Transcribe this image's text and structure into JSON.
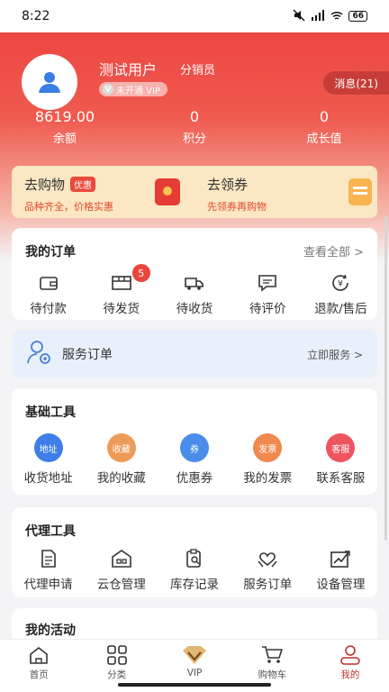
{
  "status": {
    "time": "8:22",
    "battery": "66"
  },
  "profile": {
    "username": "测试用户",
    "role": "分销员",
    "vip_status": "未开通 VIP",
    "messages_label": "消息(21)"
  },
  "stats": [
    {
      "value": "8619.00",
      "label": "余额"
    },
    {
      "value": "0",
      "label": "积分"
    },
    {
      "value": "0",
      "label": "成长值"
    }
  ],
  "promo": {
    "shop": {
      "title": "去购物",
      "badge": "优惠",
      "subtitle": "品种齐全，价格实惠"
    },
    "coupon": {
      "title": "去领券",
      "subtitle": "先领券再购物"
    }
  },
  "orders": {
    "title": "我的订单",
    "view_all": "查看全部 >",
    "items": [
      {
        "label": "待付款",
        "icon": "wallet-icon"
      },
      {
        "label": "待发货",
        "icon": "package-icon",
        "badge": "5"
      },
      {
        "label": "待收货",
        "icon": "truck-icon"
      },
      {
        "label": "待评价",
        "icon": "comment-icon"
      },
      {
        "label": "退款/售后",
        "icon": "refund-icon"
      }
    ]
  },
  "service": {
    "title": "服务订单",
    "link": "立即服务 >"
  },
  "basic_tools": {
    "title": "基础工具",
    "items": [
      {
        "label": "收货地址",
        "icon_text": "地址",
        "color": "#3f7ee8"
      },
      {
        "label": "我的收藏",
        "icon_text": "收藏",
        "color": "#ee9b5a"
      },
      {
        "label": "优惠券",
        "icon_text": "券",
        "color": "#4a8cea"
      },
      {
        "label": "我的发票",
        "icon_text": "发票",
        "color": "#f0894f"
      },
      {
        "label": "联系客服",
        "icon_text": "客服",
        "color": "#ec5560"
      }
    ]
  },
  "agent_tools": {
    "title": "代理工具",
    "items": [
      {
        "label": "代理申请",
        "icon": "document-icon"
      },
      {
        "label": "云仓管理",
        "icon": "warehouse-icon"
      },
      {
        "label": "库存记录",
        "icon": "clipboard-search-icon"
      },
      {
        "label": "服务订单",
        "icon": "handshake-icon"
      },
      {
        "label": "设备管理",
        "icon": "chart-icon"
      }
    ]
  },
  "activities": {
    "title": "我的活动"
  },
  "tabbar": [
    {
      "label": "首页",
      "icon": "home-icon"
    },
    {
      "label": "分类",
      "icon": "grid-icon"
    },
    {
      "label": "VIP",
      "icon": "vip-crown-icon"
    },
    {
      "label": "购物车",
      "icon": "cart-icon"
    },
    {
      "label": "我的",
      "icon": "user-icon",
      "active": true
    }
  ],
  "colors": {
    "brand": "#e8453c",
    "promo_bg": "#fbe7c3",
    "service_bg": "#e8f0fb"
  }
}
